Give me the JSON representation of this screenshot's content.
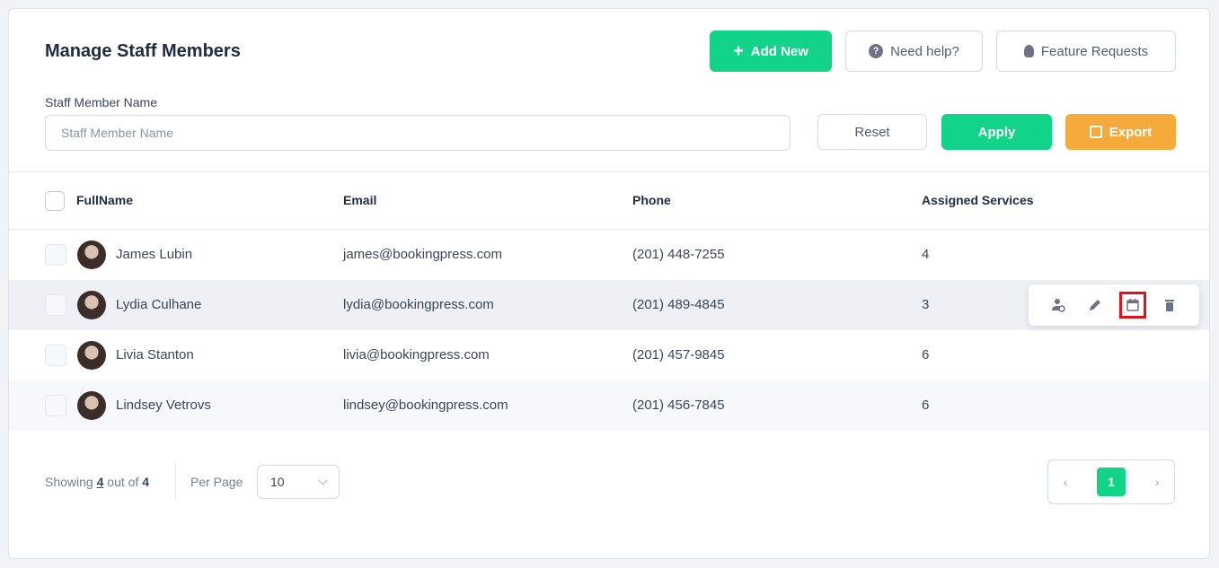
{
  "header": {
    "title": "Manage Staff Members",
    "add_new": "Add New",
    "need_help": "Need help?",
    "feature_requests": "Feature Requests"
  },
  "filter": {
    "label": "Staff Member Name",
    "placeholder": "Staff Member Name",
    "reset": "Reset",
    "apply": "Apply",
    "export": "Export"
  },
  "table": {
    "columns": [
      "FullName",
      "Email",
      "Phone",
      "Assigned Services"
    ],
    "rows": [
      {
        "name": "James Lubin",
        "email": "james@bookingpress.com",
        "phone": "(201) 448-7255",
        "services": "4"
      },
      {
        "name": "Lydia Culhane",
        "email": "lydia@bookingpress.com",
        "phone": "(201) 489-4845",
        "services": "3"
      },
      {
        "name": "Livia Stanton",
        "email": "livia@bookingpress.com",
        "phone": "(201) 457-9845",
        "services": "6"
      },
      {
        "name": "Lindsey Vetrovs",
        "email": "lindsey@bookingpress.com",
        "phone": "(201) 456-7845",
        "services": "6"
      }
    ]
  },
  "row_actions": [
    "user-settings-icon",
    "edit-icon",
    "calendar-icon",
    "trash-icon"
  ],
  "footer": {
    "showing_prefix": "Showing",
    "shown": "4",
    "out_of": "out of",
    "total": "4",
    "per_page_label": "Per Page",
    "per_page_value": "10",
    "prev": "‹",
    "current_page": "1",
    "next": "›"
  },
  "colors": {
    "accent": "#12d488",
    "export": "#f5ab3b",
    "highlight": "#e0131b"
  }
}
